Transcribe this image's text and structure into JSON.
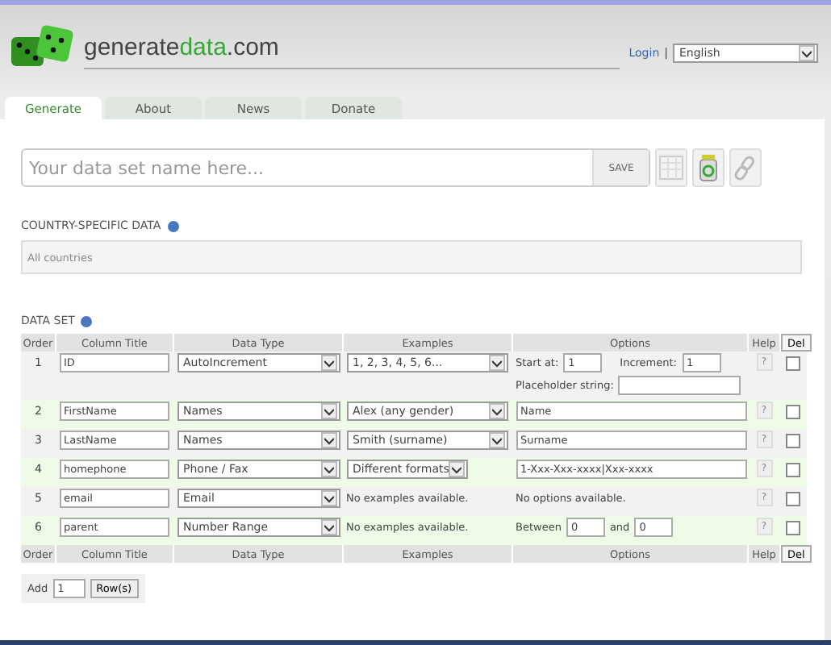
{
  "logo": {
    "prefix": "generate",
    "highlight": "data",
    "suffix": ".com"
  },
  "login": "Login",
  "separator": "|",
  "language": "English",
  "tabs": [
    {
      "label": "Generate",
      "selected": true
    },
    {
      "label": "About",
      "selected": false
    },
    {
      "label": "News",
      "selected": false
    },
    {
      "label": "Donate",
      "selected": false
    }
  ],
  "name_field": {
    "placeholder": "Your data set name here..."
  },
  "save_button": "SAVE",
  "country": {
    "heading": "COUNTRY-SPECIFIC DATA",
    "placeholder": "All countries"
  },
  "data_set": {
    "heading": "DATA SET",
    "columns": [
      "Order",
      "Column Title",
      "Data Type",
      "Examples",
      "Options",
      "Help",
      "Del"
    ],
    "rows": [
      {
        "order": "1",
        "title": "ID",
        "data_type": "AutoIncrement",
        "examples": {
          "kind": "select",
          "text": "1, 2, 3, 4, 5, 6..."
        },
        "options": {
          "kind": "increment",
          "start_label": "Start at:",
          "start": "1",
          "increment_label": "Increment:",
          "increment": "1",
          "placeholder_label": "Placeholder string:"
        },
        "help": "?",
        "checked": false
      },
      {
        "order": "2",
        "title": "FirstName",
        "data_type": "Names",
        "examples": {
          "kind": "select",
          "text": "Alex (any gender)"
        },
        "options": {
          "kind": "field",
          "value": "Name"
        },
        "help": "?",
        "checked": false
      },
      {
        "order": "3",
        "title": "LastName",
        "data_type": "Names",
        "examples": {
          "kind": "select",
          "text": "Smith (surname)"
        },
        "options": {
          "kind": "field",
          "value": "Surname"
        },
        "help": "?",
        "checked": false
      },
      {
        "order": "4",
        "title": "homephone",
        "data_type": "Phone / Fax",
        "examples": {
          "kind": "short-select",
          "text": "Different formats"
        },
        "options": {
          "kind": "field",
          "value": "1-Xxx-Xxx-xxxx|Xxx-xxxx"
        },
        "help": "?",
        "checked": false
      },
      {
        "order": "5",
        "title": "email",
        "data_type": "Email",
        "examples": {
          "kind": "text",
          "text": "No examples available."
        },
        "options": {
          "kind": "text",
          "text": "No options available."
        },
        "help": "?",
        "checked": false
      },
      {
        "order": "6",
        "title": "parent",
        "data_type": "Number Range",
        "examples": {
          "kind": "text",
          "text": "No examples available."
        },
        "options": {
          "kind": "range",
          "from_label": "Between",
          "from": "0",
          "to_label": "and",
          "to": "0"
        },
        "help": "?",
        "checked": false
      }
    ],
    "footer_columns": [
      "Order",
      "Column Title",
      "Data Type",
      "Examples",
      "Options",
      "Help",
      "Del"
    ]
  },
  "add_rows": {
    "label": "Add",
    "count": "1",
    "button": "Row(s)"
  }
}
